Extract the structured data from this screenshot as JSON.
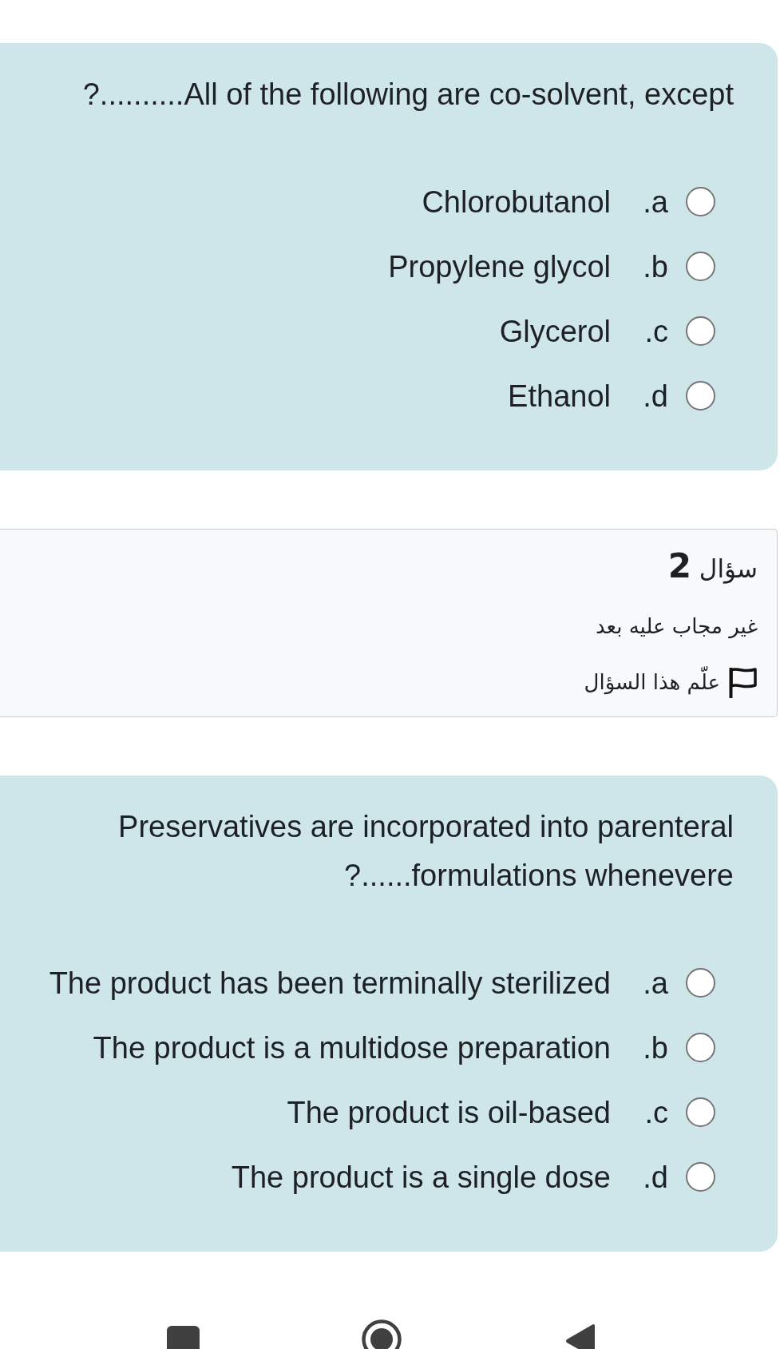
{
  "questions": [
    {
      "text": "?..........All of the following are co-solvent, except",
      "options": [
        {
          "letter": ".a",
          "label": "Chlorobutanol",
          "selected": false
        },
        {
          "letter": ".b",
          "label": "Propylene glycol",
          "selected": false
        },
        {
          "letter": ".c",
          "label": "Glycerol",
          "selected": false
        },
        {
          "letter": ".d",
          "label": "Ethanol",
          "selected": false
        }
      ]
    },
    {
      "info": {
        "label": "سؤال",
        "number": "2",
        "status": "غير مجاب عليه بعد",
        "flag_text": "علّم هذا السؤال",
        "flagged": false
      },
      "text": "Preservatives are incorporated into parenteral\n?......formulations whenevere",
      "options": [
        {
          "letter": ".a",
          "label": "The product has been terminally sterilized",
          "selected": false
        },
        {
          "letter": ".b",
          "label": "The product is a multidose preparation",
          "selected": false
        },
        {
          "letter": ".c",
          "label": "The product is oil-based",
          "selected": false
        },
        {
          "letter": ".d",
          "label": "The product is a single dose",
          "selected": false
        }
      ]
    }
  ]
}
